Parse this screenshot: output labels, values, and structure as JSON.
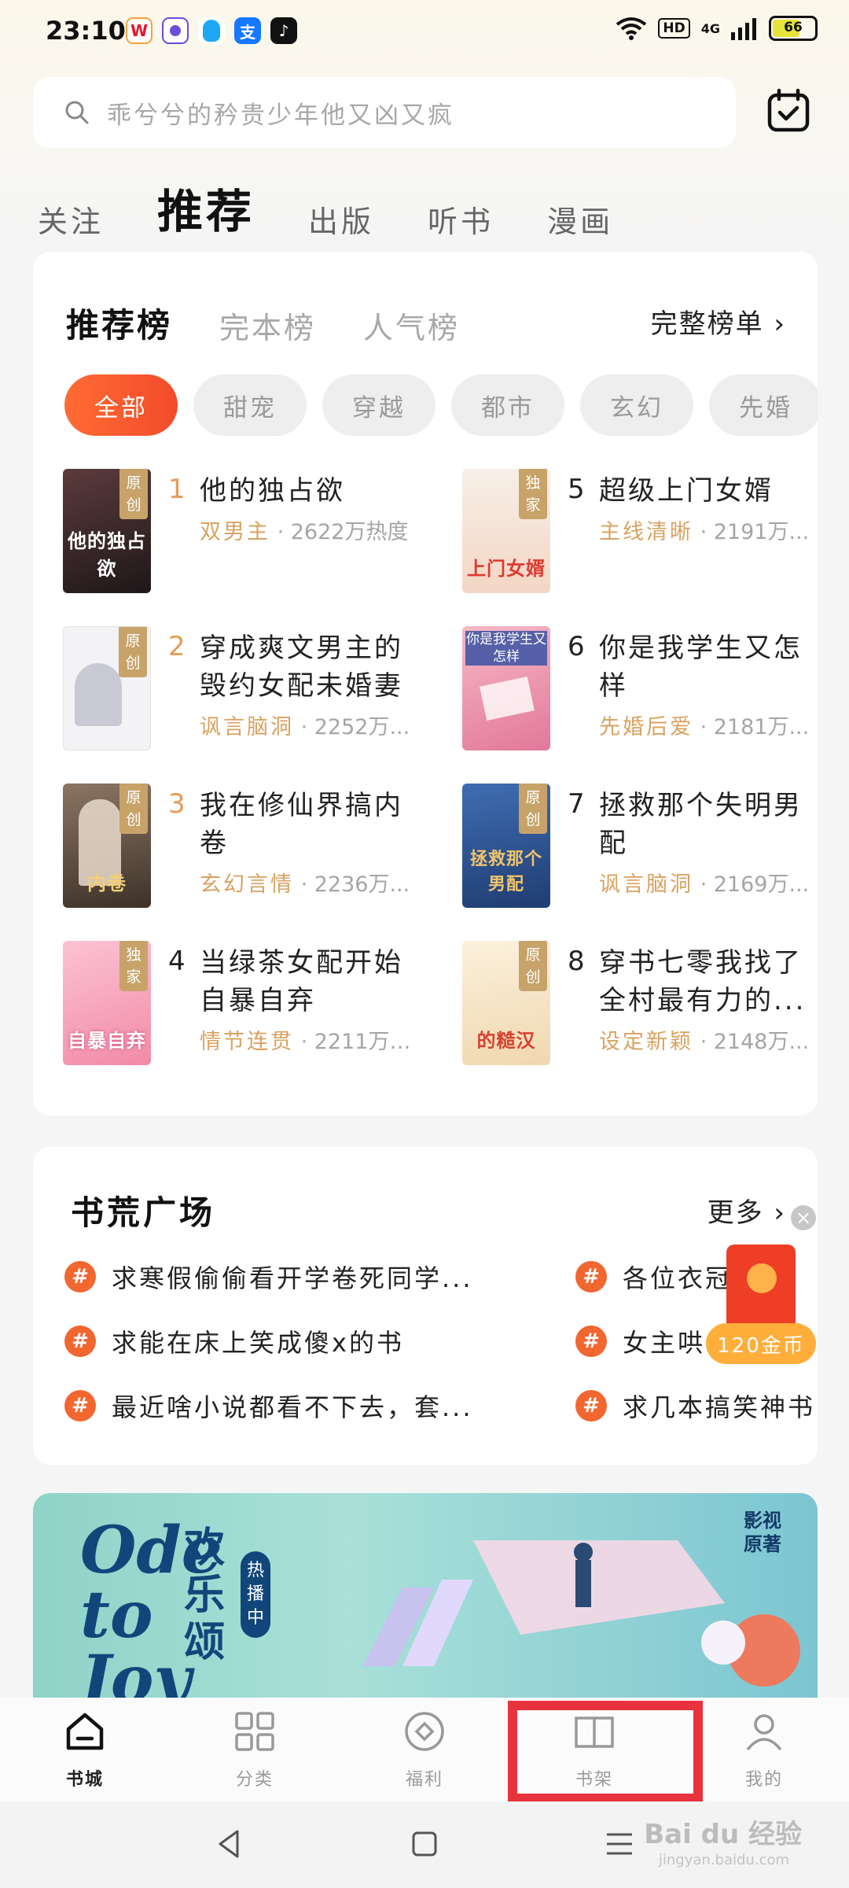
{
  "status_bar": {
    "time": "23:10",
    "network": "4G",
    "hd": "HD",
    "battery": "66",
    "apps": [
      "weibo-icon",
      "soul-icon",
      "qq-icon",
      "alipay-icon",
      "tiktok-icon"
    ]
  },
  "search": {
    "placeholder": "乖兮兮的矜贵少年他又凶又疯"
  },
  "top_tabs": [
    {
      "label": "关注",
      "active": false
    },
    {
      "label": "推荐",
      "active": true
    },
    {
      "label": "出版",
      "active": false
    },
    {
      "label": "听书",
      "active": false
    },
    {
      "label": "漫画",
      "active": false
    }
  ],
  "ranking": {
    "tabs": [
      "推荐榜",
      "完本榜",
      "人气榜"
    ],
    "active_tab": "推荐榜",
    "full_list_label": "完整榜单 ›",
    "chips": [
      "全部",
      "甜宠",
      "穿越",
      "都市",
      "玄幻",
      "先婚"
    ],
    "active_chip": "全部",
    "books": [
      {
        "rank": "1",
        "title": "他的独占欲",
        "tag": "双男主",
        "heat": " · 2622万热度",
        "badge": "原创",
        "cover_text": "他的独占欲",
        "cover_color": "#3a2b2e"
      },
      {
        "rank": "2",
        "title": "穿成爽文男主的毁约女配未婚妻",
        "tag": "脑洞",
        "heat": " · 2252万...",
        "tag_full": "讽言脑洞",
        "badge": "原创",
        "cover_text": "",
        "cover_color": "#f1f1f4"
      },
      {
        "rank": "3",
        "title": "我在修仙界搞内卷",
        "tag": "玄幻言情",
        "heat": " · 2236万...",
        "badge": "原创",
        "cover_text": "内卷",
        "cover_color": "#6b5a4a"
      },
      {
        "rank": "4",
        "title": "当绿茶女配开始自暴自弃",
        "tag": "情节连贯",
        "heat": " · 2211万热度",
        "badge": "独家",
        "cover_text": "自暴自弃",
        "cover_color": "#f6a7bd"
      },
      {
        "rank": "5",
        "title": "超级上门女婿",
        "tag": "主线清晰",
        "heat": " · 2191万...",
        "badge": "独家",
        "cover_text": "上门女婿",
        "cover_color": "#f5efe8"
      },
      {
        "rank": "6",
        "title": "你是我学生又怎样",
        "tag": "先婚后爱",
        "heat": " · 2181万...",
        "badge": "",
        "cover_text": "你是我学生又怎样",
        "cover_color": "#e97d92"
      },
      {
        "rank": "7",
        "title": "拯救那个失明男配",
        "tag": "讽言脑洞",
        "heat": " · 2169万...",
        "badge": "原创",
        "cover_text": "拯救那个男配",
        "cover_color": "#2f5a9a"
      },
      {
        "rank": "8",
        "title": "穿书七零我找了全村最有力的...",
        "tag": "设定新颖",
        "heat": " · 2148万...",
        "badge": "原创",
        "cover_text": "的糙汉",
        "cover_color": "#f6e4c6"
      }
    ]
  },
  "square": {
    "title": "书荒广场",
    "more_label": "更多 ›",
    "topics_left": [
      "求寒假偷偷看开学卷死同学...",
      "求能在床上笑成傻x的书",
      "最近啥小说都看不下去，套..."
    ],
    "topics_right": [
      "各位衣冠不",
      "女主哄",
      "求几本搞笑神书"
    ]
  },
  "red_packet": {
    "amount": "120金币"
  },
  "banner": {
    "ode": "Ode to Joy",
    "cn_title": "欢乐颂",
    "hot_tag": "热播中",
    "side_tag": "影视原著"
  },
  "bottom_nav": [
    {
      "label": "书城",
      "icon": "home-icon",
      "active": true
    },
    {
      "label": "分类",
      "icon": "grid-icon",
      "active": false
    },
    {
      "label": "福利",
      "icon": "diamond-icon",
      "active": false
    },
    {
      "label": "书架",
      "icon": "book-icon",
      "active": false
    },
    {
      "label": "我的",
      "icon": "user-icon",
      "active": false
    }
  ],
  "watermark": {
    "brand": "Bai du 经验",
    "url": "jingyan.baidu.com"
  },
  "colors": {
    "accent": "#f2662f",
    "tag": "#d9a260",
    "highlight": "#e8323e"
  }
}
